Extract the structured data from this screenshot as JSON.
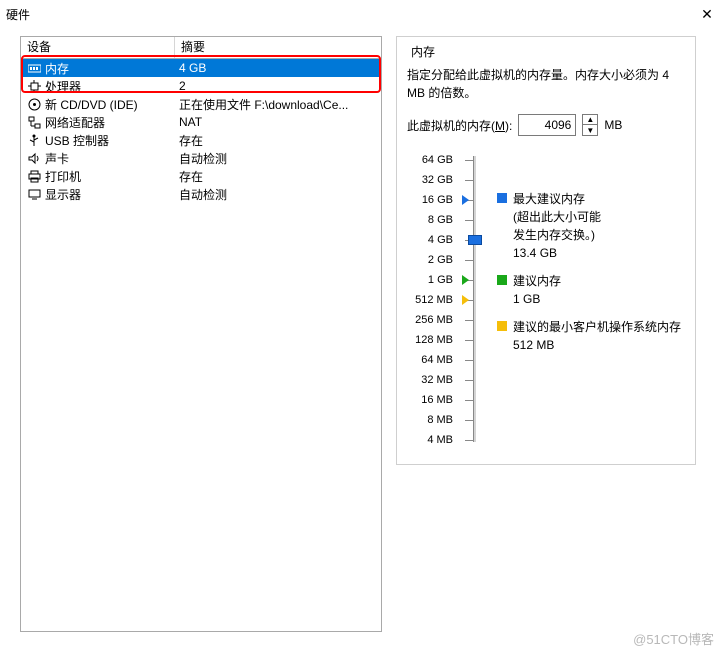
{
  "window": {
    "title": "硬件"
  },
  "device_table": {
    "headers": {
      "device": "设备",
      "summary": "摘要"
    },
    "rows": [
      {
        "icon": "memory-icon",
        "name": "内存",
        "summary": "4 GB",
        "selected": true
      },
      {
        "icon": "cpu-icon",
        "name": "处理器",
        "summary": "2"
      },
      {
        "icon": "cdrom-icon",
        "name": "新 CD/DVD (IDE)",
        "summary": "正在使用文件 F:\\download\\Ce..."
      },
      {
        "icon": "network-icon",
        "name": "网络适配器",
        "summary": "NAT"
      },
      {
        "icon": "usb-icon",
        "name": "USB 控制器",
        "summary": "存在"
      },
      {
        "icon": "sound-icon",
        "name": "声卡",
        "summary": "自动检测"
      },
      {
        "icon": "printer-icon",
        "name": "打印机",
        "summary": "存在"
      },
      {
        "icon": "display-icon",
        "name": "显示器",
        "summary": "自动检测"
      }
    ]
  },
  "memory_group": {
    "legend": "内存",
    "desc": "指定分配给此虚拟机的内存量。内存大小必须为 4 MB 的倍数。",
    "input_label_before": "此虚拟机的内存(",
    "input_label_hotkey": "M",
    "input_label_after": "):",
    "value": "4096",
    "unit": "MB",
    "ticks": [
      "64 GB",
      "32 GB",
      "16 GB",
      "8 GB",
      "4 GB",
      "2 GB",
      "1 GB",
      "512 MB",
      "256 MB",
      "128 MB",
      "64 MB",
      "32 MB",
      "16 MB",
      "8 MB",
      "4 MB"
    ],
    "markers": {
      "max_recommend": {
        "tick_index": 2,
        "color": "#1a6fe0",
        "title": "最大建议内存",
        "note1": "(超出此大小可能",
        "note2": "发生内存交换。)",
        "value": "13.4 GB"
      },
      "recommend": {
        "tick_index": 6,
        "color": "#1aa81a",
        "title": "建议内存",
        "value": "1 GB"
      },
      "min_guest": {
        "tick_index": 7,
        "color": "#f5be0a",
        "title": "建议的最小客户机操作系统内存",
        "value": "512 MB"
      }
    },
    "thumb_tick_index": 4
  },
  "watermark": "@51CTO博客"
}
